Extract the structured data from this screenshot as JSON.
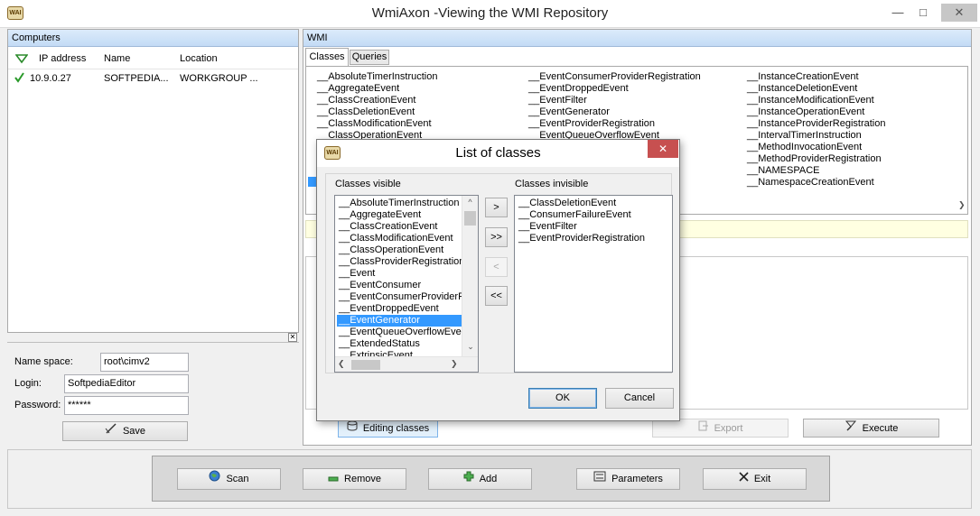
{
  "window": {
    "title": "WmiAxon -Viewing the WMI Repository",
    "icon_text": "WAI"
  },
  "computers": {
    "header": "Computers",
    "columns": [
      "IP address",
      "Name",
      "Location"
    ],
    "rows": [
      {
        "ip": "10.9.0.27",
        "name": "SOFTPEDIA...",
        "location": "WORKGROUP ..."
      }
    ]
  },
  "login": {
    "namespace_label": "Name space:",
    "namespace_value": "root\\cimv2",
    "login_label": "Login:",
    "login_value": "SoftpediaEditor",
    "password_label": "Password:",
    "password_value": "******",
    "save_label": "Save"
  },
  "wmi": {
    "header": "WMI",
    "tabs": [
      "Classes",
      "Queries"
    ],
    "classes_col1": [
      "__AbsoluteTimerInstruction",
      "__AggregateEvent",
      "__ClassCreationEvent",
      "__ClassDeletionEvent",
      "__ClassModificationEvent",
      "__ClassOperationEvent"
    ],
    "classes_col2": [
      "__EventConsumerProviderRegistration",
      "__EventDroppedEvent",
      "__EventFilter",
      "__EventGenerator",
      "__EventProviderRegistration",
      "__EventQueueOverflowEvent"
    ],
    "classes_col3": [
      "__InstanceCreationEvent",
      "__InstanceDeletionEvent",
      "__InstanceModificationEvent",
      "__InstanceOperationEvent",
      "__InstanceProviderRegistration",
      "__IntervalTimerInstruction",
      "__MethodInvocationEvent",
      "__MethodProviderRegistration",
      "__NAMESPACE",
      "__NamespaceCreationEvent"
    ],
    "editing_classes_label": "Editing classes",
    "export_label": "Export",
    "execute_label": "Execute"
  },
  "dialog": {
    "title": "List of classes",
    "visible_label": "Classes visible",
    "invisible_label": "Classes invisible",
    "visible_items": [
      "__AbsoluteTimerInstruction",
      "__AggregateEvent",
      "__ClassCreationEvent",
      "__ClassModificationEvent",
      "__ClassOperationEvent",
      "__ClassProviderRegistration",
      "__Event",
      "__EventConsumer",
      "__EventConsumerProviderRe",
      "__EventDroppedEvent",
      "__EventGenerator",
      "__EventQueueOverflowEven",
      "__ExtendedStatus",
      "__ExtrinsicEvent"
    ],
    "visible_selected": "__EventGenerator",
    "invisible_items": [
      "__ClassDeletionEvent",
      "__ConsumerFailureEvent",
      "__EventFilter",
      "__EventProviderRegistration"
    ],
    "move_right": ">",
    "move_all_right": ">>",
    "move_left": "<",
    "move_all_left": "<<",
    "ok_label": "OK",
    "cancel_label": "Cancel"
  },
  "bottom_bar": {
    "scan_label": "Scan",
    "remove_label": "Remove",
    "add_label": "Add",
    "parameters_label": "Parameters",
    "exit_label": "Exit"
  },
  "colors": {
    "selection": "#3399ff",
    "panel_header": "#c3dbf5",
    "dialog_close": "#c75050",
    "check": "#2a9a2a"
  }
}
